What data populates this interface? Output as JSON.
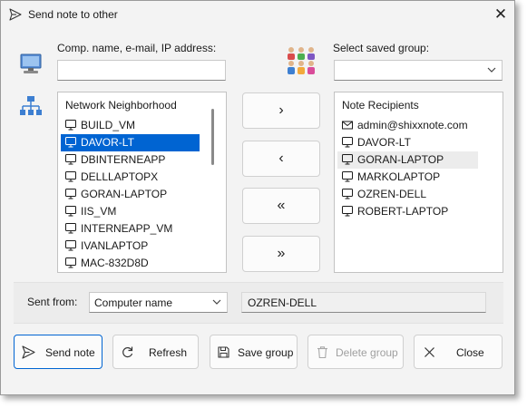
{
  "window": {
    "title": "Send note to other"
  },
  "target": {
    "label": "Comp. name, e-mail, IP address:",
    "value": ""
  },
  "saved_group": {
    "label": "Select saved group:",
    "selected": ""
  },
  "network": {
    "header": "Network Neighborhood",
    "items": [
      {
        "label": "BUILD_VM",
        "icon": "monitor-icon",
        "selected": false
      },
      {
        "label": "DAVOR-LT",
        "icon": "monitor-icon",
        "selected": true
      },
      {
        "label": "DBINTERNEAPP",
        "icon": "monitor-icon",
        "selected": false
      },
      {
        "label": "DELLLAPTOPX",
        "icon": "monitor-icon",
        "selected": false
      },
      {
        "label": "GORAN-LAPTOP",
        "icon": "monitor-icon",
        "selected": false
      },
      {
        "label": "IIS_VM",
        "icon": "monitor-icon",
        "selected": false
      },
      {
        "label": "INTERNEAPP_VM",
        "icon": "monitor-icon",
        "selected": false
      },
      {
        "label": "IVANLAPTOP",
        "icon": "monitor-icon",
        "selected": false
      },
      {
        "label": "MAC-832D8D",
        "icon": "monitor-icon",
        "selected": false
      }
    ]
  },
  "transfer": {
    "add": "›",
    "remove": "‹",
    "remove_all": "«",
    "add_all": "»"
  },
  "recipients": {
    "header": "Note Recipients",
    "items": [
      {
        "label": "admin@shixxnote.com",
        "icon": "envelope-icon",
        "highlighted": false
      },
      {
        "label": "DAVOR-LT",
        "icon": "monitor-icon",
        "highlighted": false
      },
      {
        "label": "GORAN-LAPTOP",
        "icon": "monitor-icon",
        "highlighted": true
      },
      {
        "label": "MARKOLAPTOP",
        "icon": "monitor-icon",
        "highlighted": false
      },
      {
        "label": "OZREN-DELL",
        "icon": "monitor-icon",
        "highlighted": false
      },
      {
        "label": "ROBERT-LAPTOP",
        "icon": "monitor-icon",
        "highlighted": false
      }
    ]
  },
  "sent_from": {
    "label": "Sent from:",
    "mode": "Computer name",
    "value": "OZREN-DELL"
  },
  "buttons": {
    "send": "Send note",
    "refresh": "Refresh",
    "save_group": "Save group",
    "delete_group": "Delete group",
    "close": "Close"
  },
  "colors": {
    "selection": "#0064d2",
    "accent": "#0064d2",
    "window_bg": "#f3f3f3"
  }
}
